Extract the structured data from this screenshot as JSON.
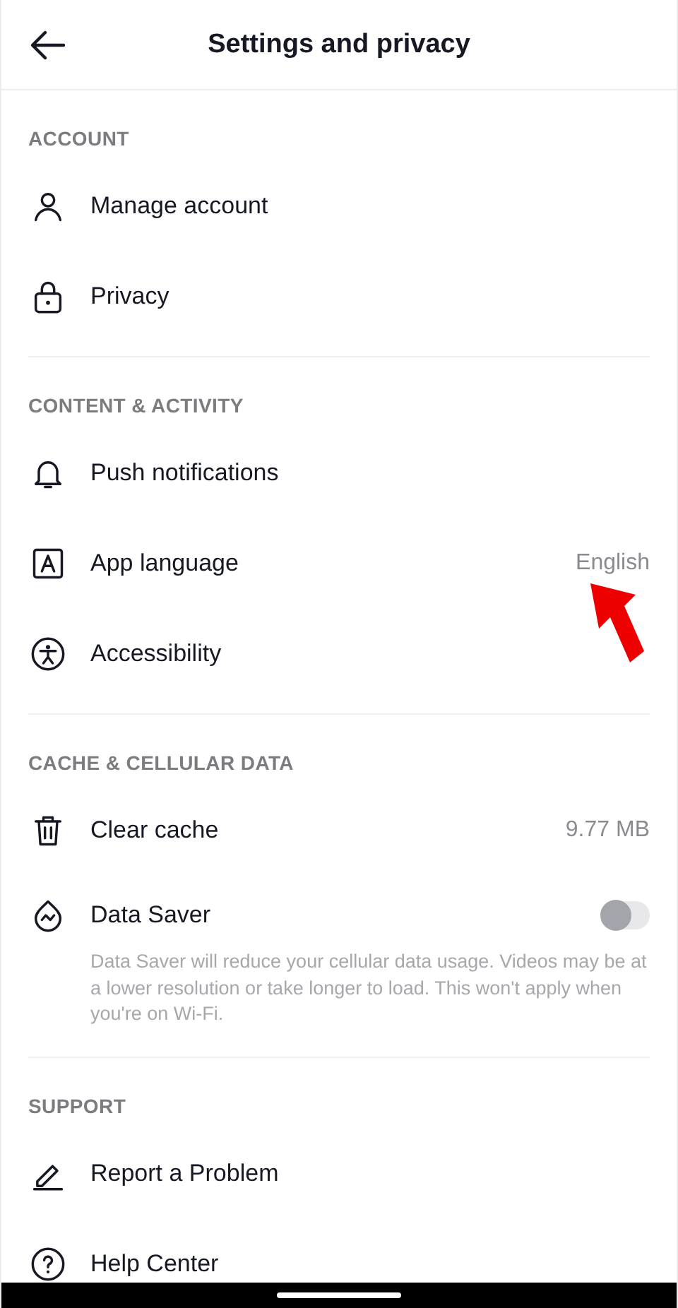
{
  "header": {
    "title": "Settings and privacy"
  },
  "sections": [
    {
      "title": "ACCOUNT",
      "items": [
        {
          "kind": "link",
          "label": "Manage account"
        },
        {
          "kind": "link",
          "label": "Privacy"
        }
      ]
    },
    {
      "title": "CONTENT & ACTIVITY",
      "items": [
        {
          "kind": "link",
          "label": "Push notifications"
        },
        {
          "kind": "value",
          "label": "App language",
          "value": "English"
        },
        {
          "kind": "link",
          "label": "Accessibility"
        }
      ]
    },
    {
      "title": "CACHE & CELLULAR DATA",
      "items": [
        {
          "kind": "value",
          "label": "Clear cache",
          "value": "9.77 MB"
        },
        {
          "kind": "toggle",
          "label": "Data Saver",
          "on": false,
          "description": "Data Saver will reduce your cellular data usage. Videos may be at a lower resolution or take longer to load. This won't apply when you're on Wi-Fi."
        }
      ]
    },
    {
      "title": "SUPPORT",
      "items": [
        {
          "kind": "link",
          "label": "Report a Problem"
        },
        {
          "kind": "link",
          "label": "Help Center"
        }
      ]
    }
  ]
}
